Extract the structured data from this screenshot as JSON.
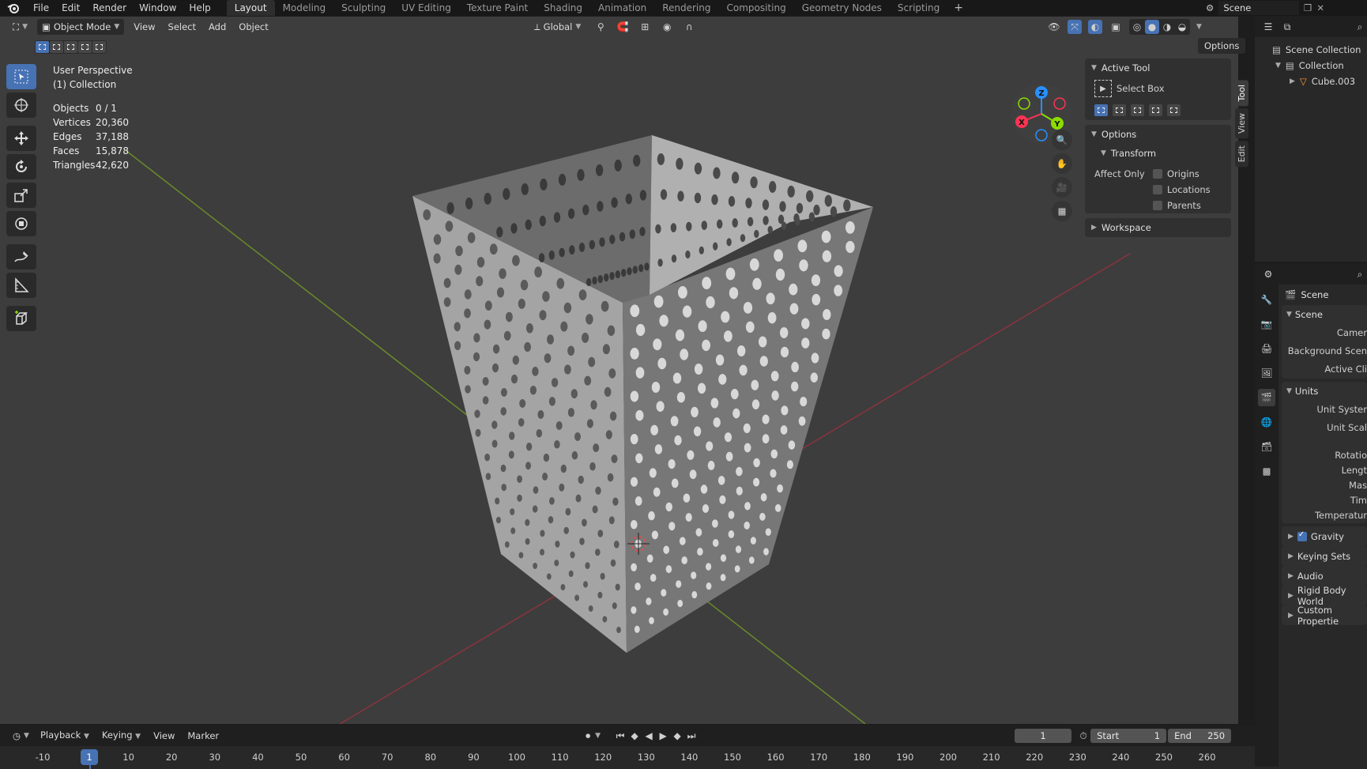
{
  "topbar": {
    "menus": [
      "File",
      "Edit",
      "Render",
      "Window",
      "Help"
    ],
    "workspaces": [
      "Layout",
      "Modeling",
      "Sculpting",
      "UV Editing",
      "Texture Paint",
      "Shading",
      "Animation",
      "Rendering",
      "Compositing",
      "Geometry Nodes",
      "Scripting"
    ],
    "active_workspace": "Layout",
    "add_tab": "+",
    "scene_name": "Scene"
  },
  "viewport": {
    "mode": "Object Mode",
    "menus": [
      "View",
      "Select",
      "Add",
      "Object"
    ],
    "transform_orientation": "Global",
    "options_label": "Options",
    "info_line1": "User Perspective",
    "info_line2": "(1) Collection",
    "stats": [
      {
        "label": "Objects",
        "value": "0 / 1"
      },
      {
        "label": "Vertices",
        "value": "20,360"
      },
      {
        "label": "Edges",
        "value": "37,188"
      },
      {
        "label": "Faces",
        "value": "15,878"
      },
      {
        "label": "Triangles",
        "value": "42,620"
      }
    ],
    "gizmo_axes": {
      "x": "X",
      "y": "Y",
      "z": "Z"
    },
    "axis_colors": {
      "x": "#ff3352",
      "y": "#8bdc00",
      "z": "#2890ff"
    }
  },
  "npanel": {
    "tabs": [
      "Tool",
      "View",
      "Edit"
    ],
    "active_tab": "Tool",
    "active_tool_header": "Active Tool",
    "tool_name": "Select Box",
    "options_header": "Options",
    "transform_header": "Transform",
    "affect_only_label": "Affect Only",
    "affect_items": [
      "Origins",
      "Locations",
      "Parents"
    ],
    "workspace_header": "Workspace"
  },
  "outliner": {
    "rows": [
      "Scene Collection",
      "Collection",
      "Cube.003"
    ]
  },
  "properties": {
    "title": "Scene",
    "scene_panel": "Scene",
    "scene_fields": [
      "Camer",
      "Background Scen",
      "Active Cli"
    ],
    "units_panel": "Units",
    "units_fields": [
      "Unit Syster",
      "Unit Scal",
      "Rotatio",
      "Lengt",
      "Mas",
      "Tim",
      "Temperatur"
    ],
    "subpanels": [
      {
        "label": "Gravity",
        "checkbox": true
      },
      {
        "label": "Keying Sets",
        "checkbox": false
      },
      {
        "label": "Audio",
        "checkbox": false
      },
      {
        "label": "Rigid Body World",
        "checkbox": false
      },
      {
        "label": "Custom Propertie",
        "checkbox": false
      }
    ]
  },
  "timeline": {
    "menus": [
      "Playback",
      "Keying",
      "View",
      "Marker"
    ],
    "current_frame": "1",
    "start_label": "Start",
    "start_value": "1",
    "end_label": "End",
    "end_value": "250",
    "ruler": [
      "-10",
      "1",
      "10",
      "20",
      "30",
      "40",
      "50",
      "60",
      "70",
      "80",
      "90",
      "100",
      "110",
      "120",
      "130",
      "140",
      "150",
      "160",
      "170",
      "180",
      "190",
      "200",
      "210",
      "220",
      "230",
      "240",
      "250",
      "260"
    ]
  }
}
